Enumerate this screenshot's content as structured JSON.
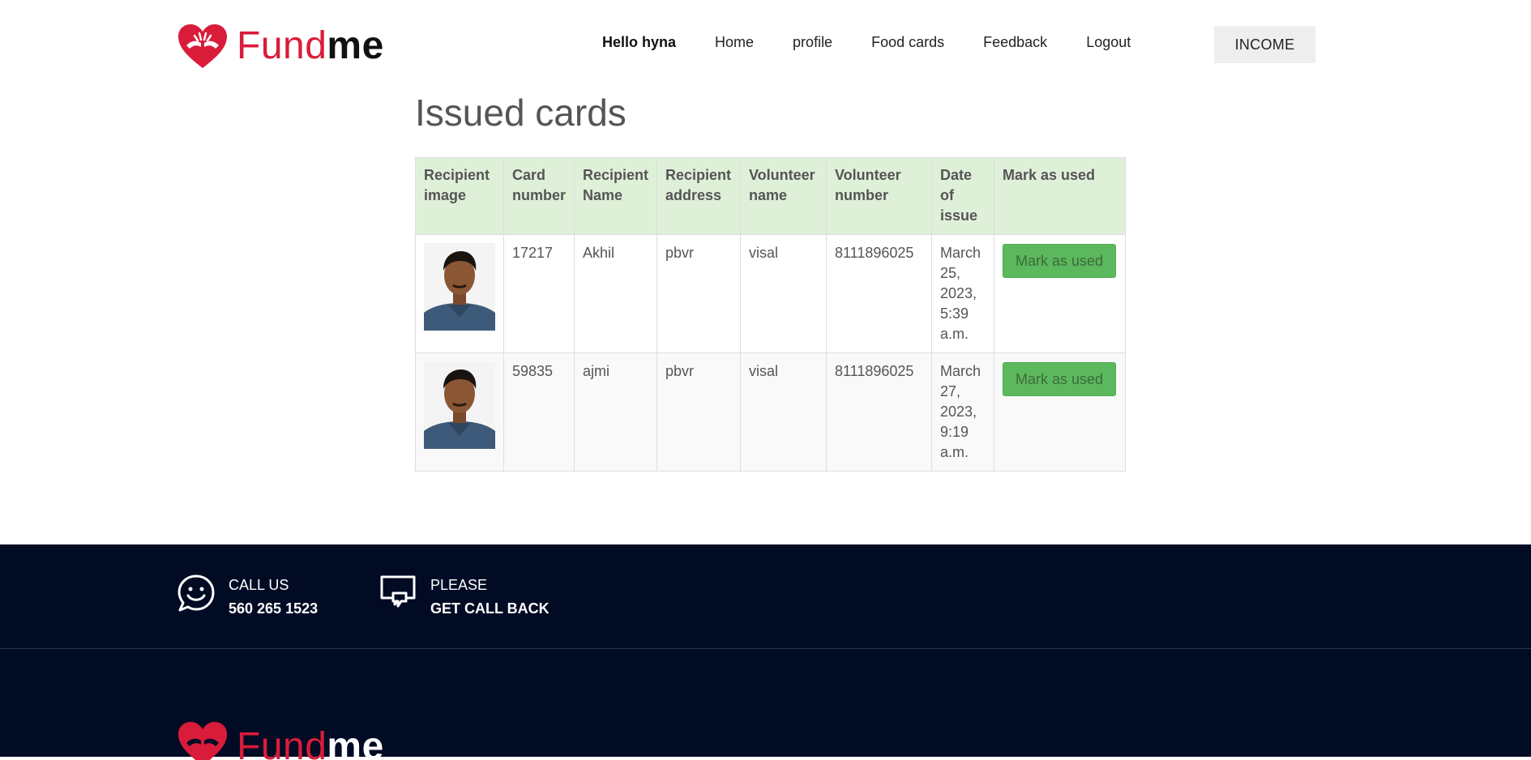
{
  "header": {
    "logo": {
      "part1": "Fund",
      "part2": "me"
    },
    "nav": {
      "greeting": "Hello hyna",
      "home": "Home",
      "profile": "profile",
      "food_cards": "Food cards",
      "feedback": "Feedback",
      "logout": "Logout"
    },
    "income_label": "INCOME"
  },
  "main": {
    "title": "Issued cards",
    "table": {
      "headers": {
        "recipient_image": "Recipient image",
        "card_number": "Card number",
        "recipient_name": "Recipient Name",
        "recipient_address": "Recipient address",
        "volunteer_name": "Volunteer name",
        "volunteer_number": "Volunteer number",
        "date_of_issue": "Date of issue",
        "mark_as_used": "Mark as used"
      },
      "rows": [
        {
          "card_number": "17217",
          "recipient_name": "Akhil",
          "recipient_address": "pbvr",
          "volunteer_name": "visal",
          "volunteer_number": "8111896025",
          "date_of_issue": "March 25, 2023, 5:39 a.m.",
          "action_label": "Mark as used"
        },
        {
          "card_number": "59835",
          "recipient_name": "ajmi",
          "recipient_address": "pbvr",
          "volunteer_name": "visal",
          "volunteer_number": "8111896025",
          "date_of_issue": "March 27, 2023, 9:19 a.m.",
          "action_label": "Mark as used"
        }
      ]
    }
  },
  "footer": {
    "call_us": {
      "label": "CALL US",
      "number": "560 265 1523",
      "icon": "smile-chat-icon"
    },
    "callback": {
      "label": "PLEASE",
      "action": "GET CALL BACK",
      "icon": "chat-bubbles-icon"
    },
    "logo": {
      "part1": "Fund",
      "part2": "me"
    }
  },
  "colors": {
    "brand_red": "#d91c3a",
    "table_header_bg": "#dff0d8",
    "button_green": "#5cb85c",
    "footer_bg": "#020b24"
  }
}
